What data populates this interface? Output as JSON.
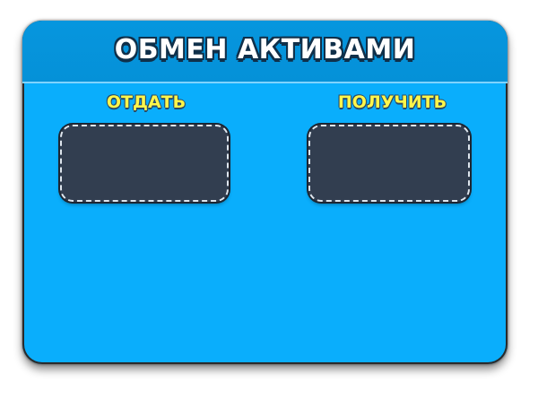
{
  "window": {
    "title": "ОБМЕН АКТИВАМИ"
  },
  "give": {
    "label": "ОТДАТЬ"
  },
  "receive": {
    "label": "ПОЛУЧИТЬ"
  },
  "colors": {
    "panel_background": "#0aaefc",
    "header_background": "#0696de",
    "label_text": "#fff64a",
    "slot_background": "#323e50"
  }
}
